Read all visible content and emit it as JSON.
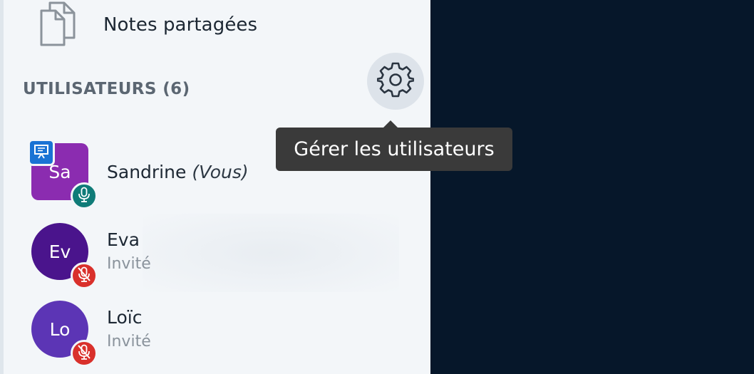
{
  "sidebar": {
    "shared_notes_label": "Notes partagées",
    "users_title": "UTILISATEURS (6)",
    "manage_users_tooltip": "Gérer les utilisateurs"
  },
  "users": [
    {
      "initials": "Sa",
      "name": "Sandrine",
      "suffix": "(Vous)",
      "role": "",
      "avatar_color": "#8b2cb0",
      "avatar_shape": "square",
      "presenter": true,
      "mic": "on"
    },
    {
      "initials": "Ev",
      "name": "Eva",
      "suffix": "",
      "role": "Invité",
      "avatar_color": "#4a148c",
      "avatar_shape": "round",
      "presenter": false,
      "mic": "muted"
    },
    {
      "initials": "Lo",
      "name": "Loïc",
      "suffix": "",
      "role": "Invité",
      "avatar_color": "#5c35b5",
      "avatar_shape": "round",
      "presenter": false,
      "mic": "muted"
    }
  ],
  "colors": {
    "mic_on": "#0f7b78",
    "mic_muted": "#d9302b",
    "presenter_badge": "#1a73d4",
    "main_area": "#06172a",
    "sidebar_bg": "#f3f6f9"
  },
  "icons": {
    "notes": "documents-icon",
    "gear": "gear-icon",
    "mic": "microphone-icon",
    "mic_muted": "microphone-muted-icon",
    "presenter": "presentation-icon"
  }
}
